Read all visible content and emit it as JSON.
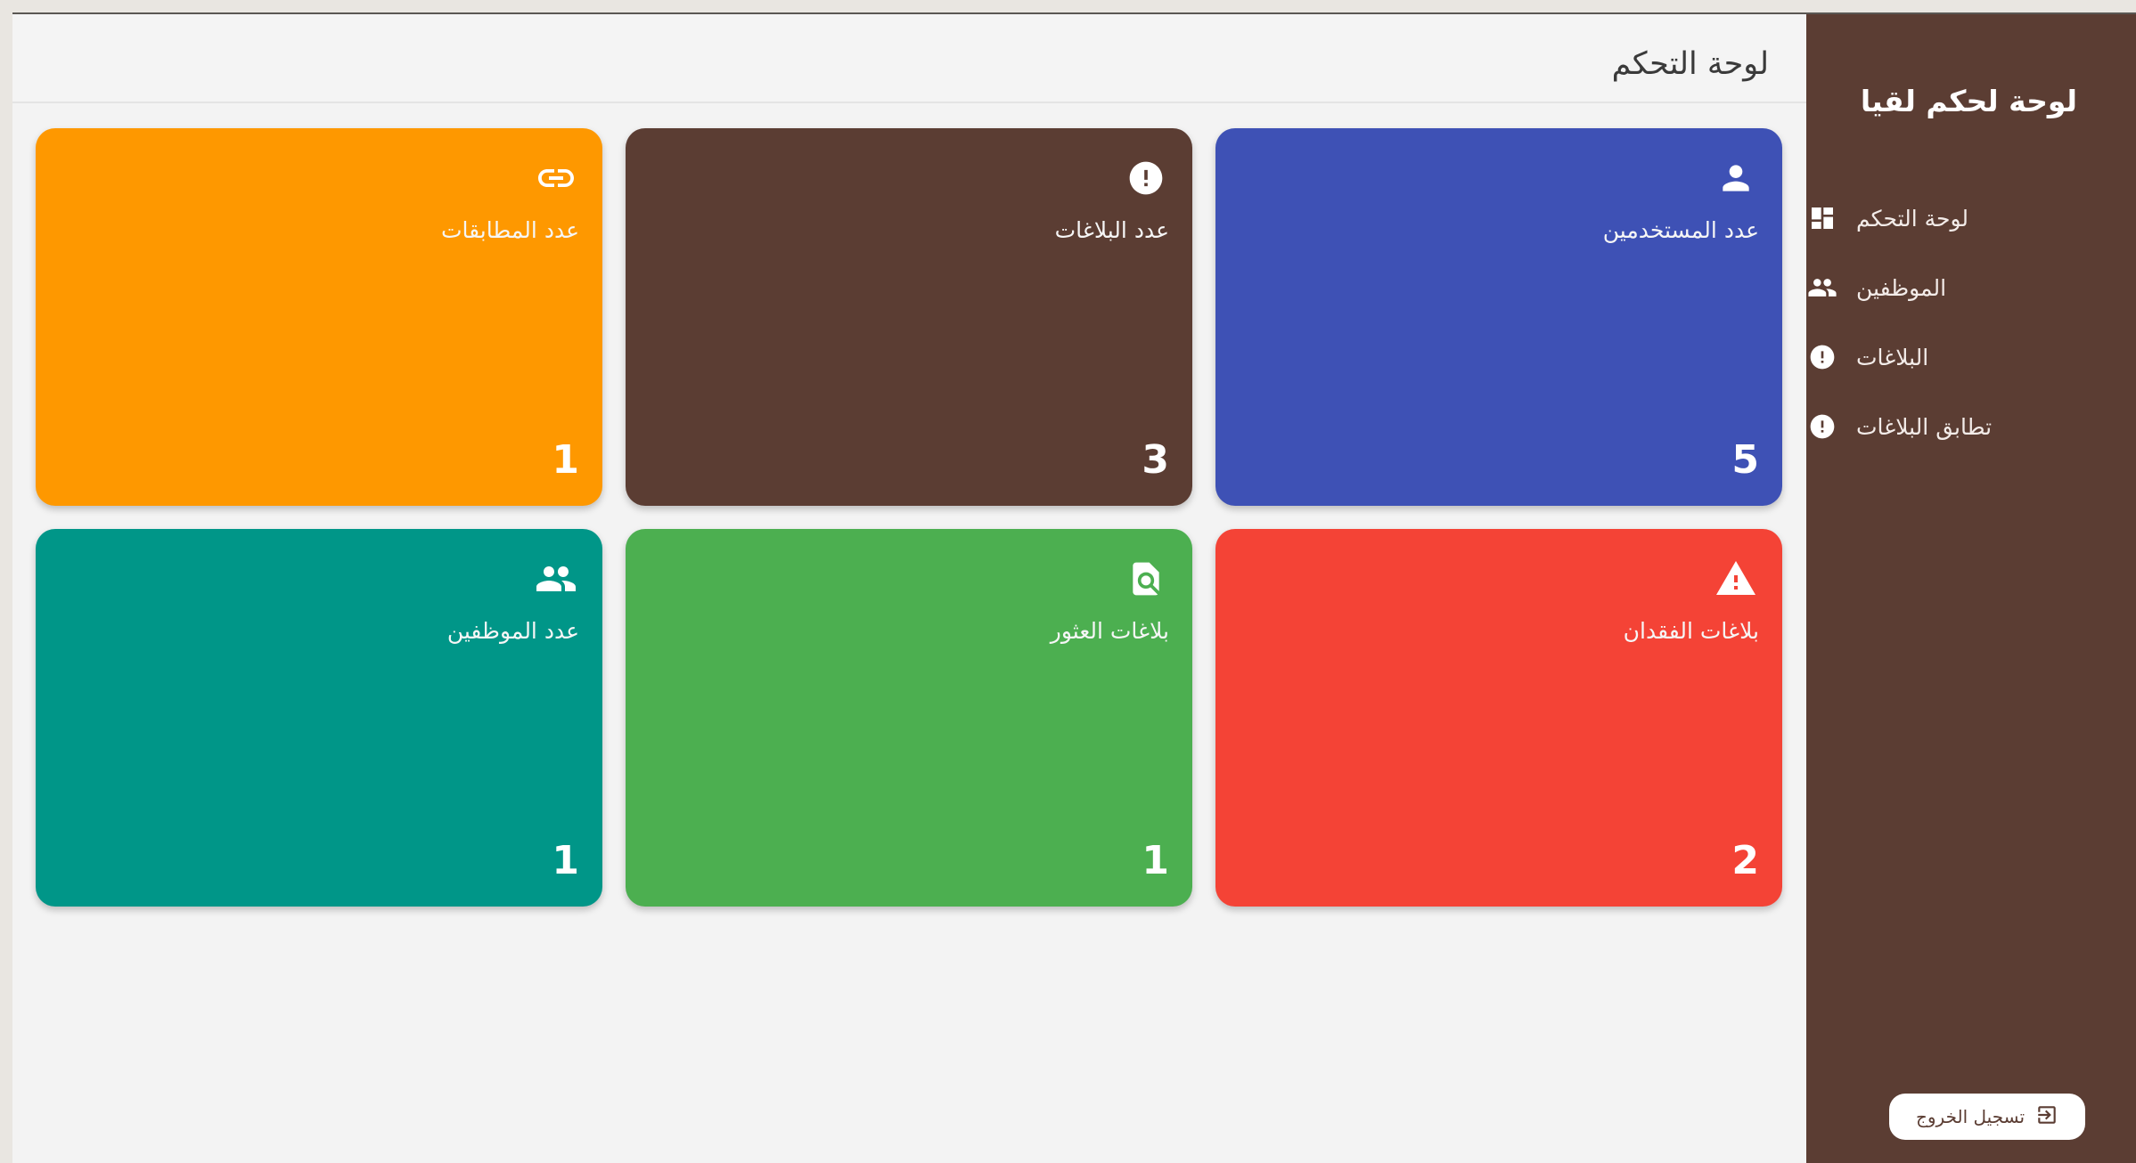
{
  "sidebar": {
    "brand": "لوحة لحكم لقيا",
    "items": [
      {
        "label": "لوحة التحكم",
        "icon": "dashboard-icon"
      },
      {
        "label": "الموظفين",
        "icon": "people-icon"
      },
      {
        "label": "البلاغات",
        "icon": "alert-circle-icon"
      },
      {
        "label": "تطابق البلاغات",
        "icon": "alert-circle-icon"
      }
    ],
    "logout_label": "تسجيل الخروج"
  },
  "header": {
    "title": "لوحة التحكم"
  },
  "cards": [
    {
      "label": "عدد المستخدمين",
      "value": "5",
      "color": "#3e51b5",
      "icon": "user-icon"
    },
    {
      "label": "عدد البلاغات",
      "value": "3",
      "color": "#5b3d33",
      "icon": "alert-circle-icon"
    },
    {
      "label": "عدد المطابقات",
      "value": "1",
      "color": "#fe9800",
      "icon": "link-icon"
    },
    {
      "label": "بلاغات الفقدان",
      "value": "2",
      "color": "#f44336",
      "icon": "warning-icon"
    },
    {
      "label": "بلاغات العثور",
      "value": "1",
      "color": "#4caf50",
      "icon": "document-search-icon"
    },
    {
      "label": "عدد الموظفين",
      "value": "1",
      "color": "#009688",
      "icon": "people-icon"
    }
  ]
}
